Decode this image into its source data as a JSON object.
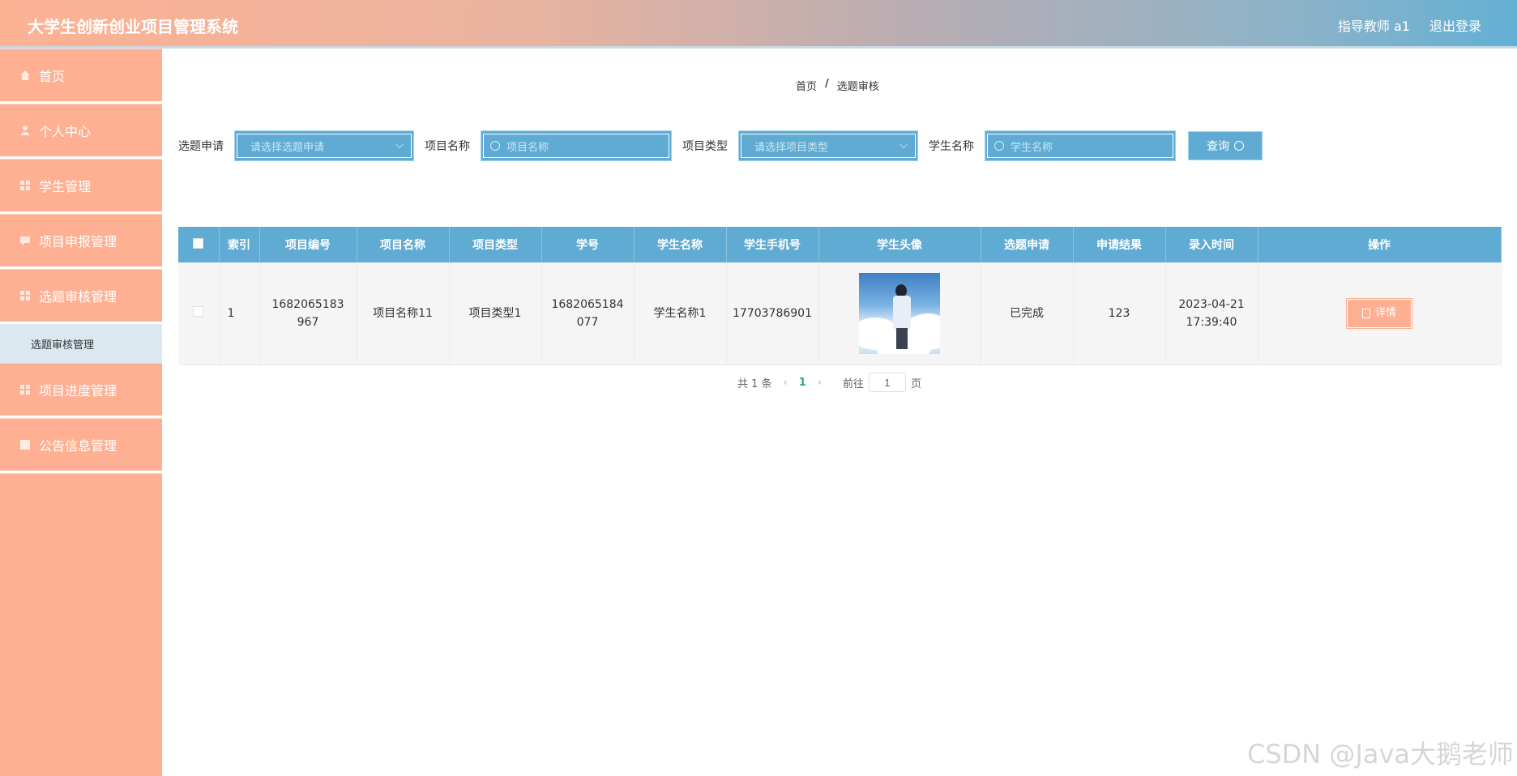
{
  "header": {
    "title": "大学生创新创业项目管理系统",
    "user": "指导教师 a1",
    "logout": "退出登录"
  },
  "sidebar": {
    "items": [
      {
        "label": "首页",
        "icon": "home-icon"
      },
      {
        "label": "个人中心",
        "icon": "user-icon"
      },
      {
        "label": "学生管理",
        "icon": "grid-icon"
      },
      {
        "label": "项目申报管理",
        "icon": "chat-icon"
      },
      {
        "label": "选题审核管理",
        "icon": "grid-icon"
      },
      {
        "label": "项目进度管理",
        "icon": "grid-icon"
      },
      {
        "label": "公告信息管理",
        "icon": "grid-icon"
      }
    ],
    "sub_item": "选题审核管理"
  },
  "breadcrumb": {
    "home": "首页",
    "sep": "/",
    "current": "选题审核"
  },
  "search": {
    "f1_label": "选题申请",
    "f1_placeholder": "请选择选题申请",
    "f2_label": "项目名称",
    "f2_placeholder": "项目名称",
    "f3_label": "项目类型",
    "f3_placeholder": "请选择项目类型",
    "f4_label": "学生名称",
    "f4_placeholder": "学生名称",
    "query_label": "查询"
  },
  "table": {
    "headers": [
      "索引",
      "项目编号",
      "项目名称",
      "项目类型",
      "学号",
      "学生名称",
      "学生手机号",
      "学生头像",
      "选题申请",
      "申请结果",
      "录入时间",
      "操作"
    ],
    "rows": [
      {
        "index": "1",
        "project_no": "1682065183967",
        "project_name": "项目名称11",
        "project_type": "项目类型1",
        "student_no": "1682065184077",
        "student_name": "学生名称1",
        "phone": "17703786901",
        "apply": "已完成",
        "result": "123",
        "time": "2023-04-21 17:39:40",
        "action": "详情"
      }
    ]
  },
  "pagination": {
    "total": "共 1 条",
    "current": "1",
    "goto_label": "前往",
    "goto_value": "1",
    "page_suffix": "页"
  },
  "watermark": "CSDN @Java大鹅老师",
  "colors": {
    "accent_blue": "#5fabd3",
    "accent_peach": "#ffb092"
  }
}
